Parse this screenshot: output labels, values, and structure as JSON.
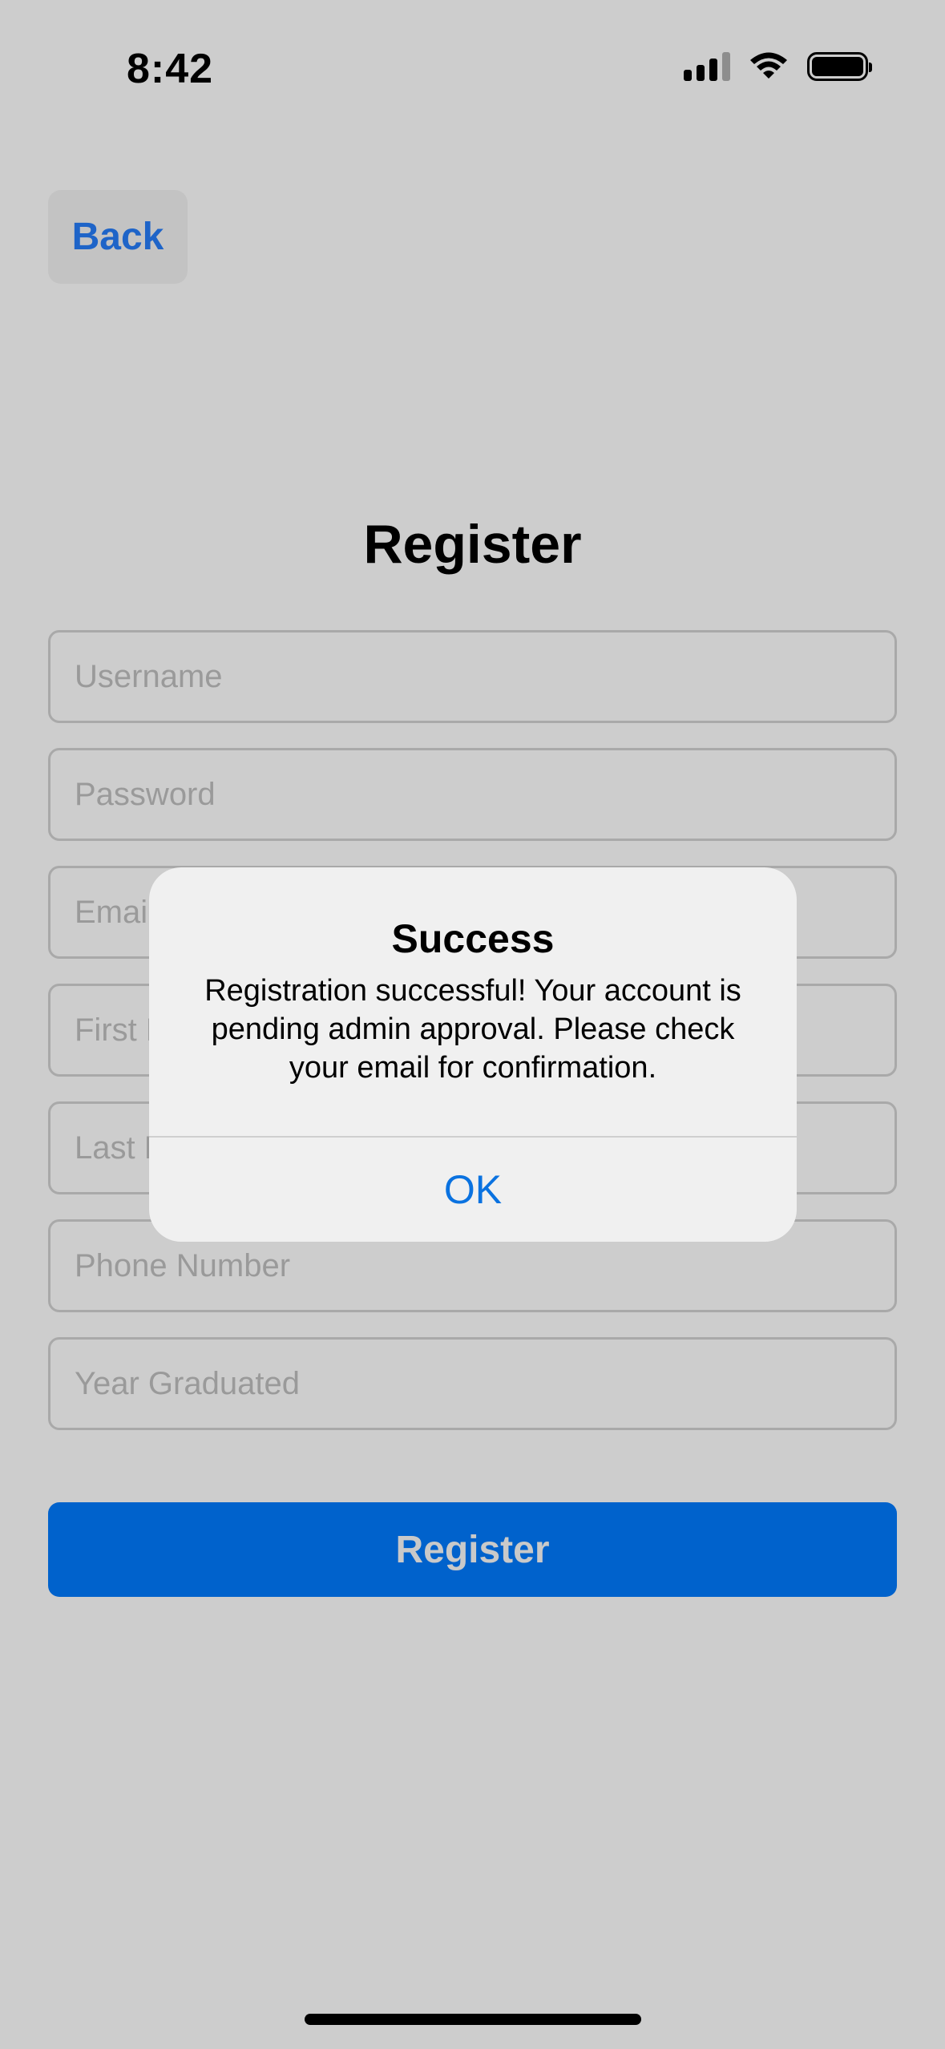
{
  "status_bar": {
    "time": "8:42"
  },
  "nav": {
    "back_label": "Back"
  },
  "page": {
    "title": "Register"
  },
  "form": {
    "fields": [
      {
        "placeholder": "Username",
        "value": ""
      },
      {
        "placeholder": "Password",
        "value": ""
      },
      {
        "placeholder": "Email",
        "value": ""
      },
      {
        "placeholder": "First Name",
        "value": ""
      },
      {
        "placeholder": "Last Name",
        "value": ""
      },
      {
        "placeholder": "Phone Number",
        "value": ""
      },
      {
        "placeholder": "Year Graduated",
        "value": ""
      }
    ],
    "submit_label": "Register"
  },
  "alert": {
    "title": "Success",
    "message": "Registration successful! Your account is pending admin approval. Please check your email for confirmation.",
    "ok_label": "OK"
  },
  "colors": {
    "accent": "#0062cc",
    "back_text": "#1e64c8",
    "alert_button": "#0a72e0",
    "dim_background": "#cdcdcd"
  },
  "icons": [
    "cellular-signal-icon",
    "wifi-icon",
    "battery-icon"
  ]
}
